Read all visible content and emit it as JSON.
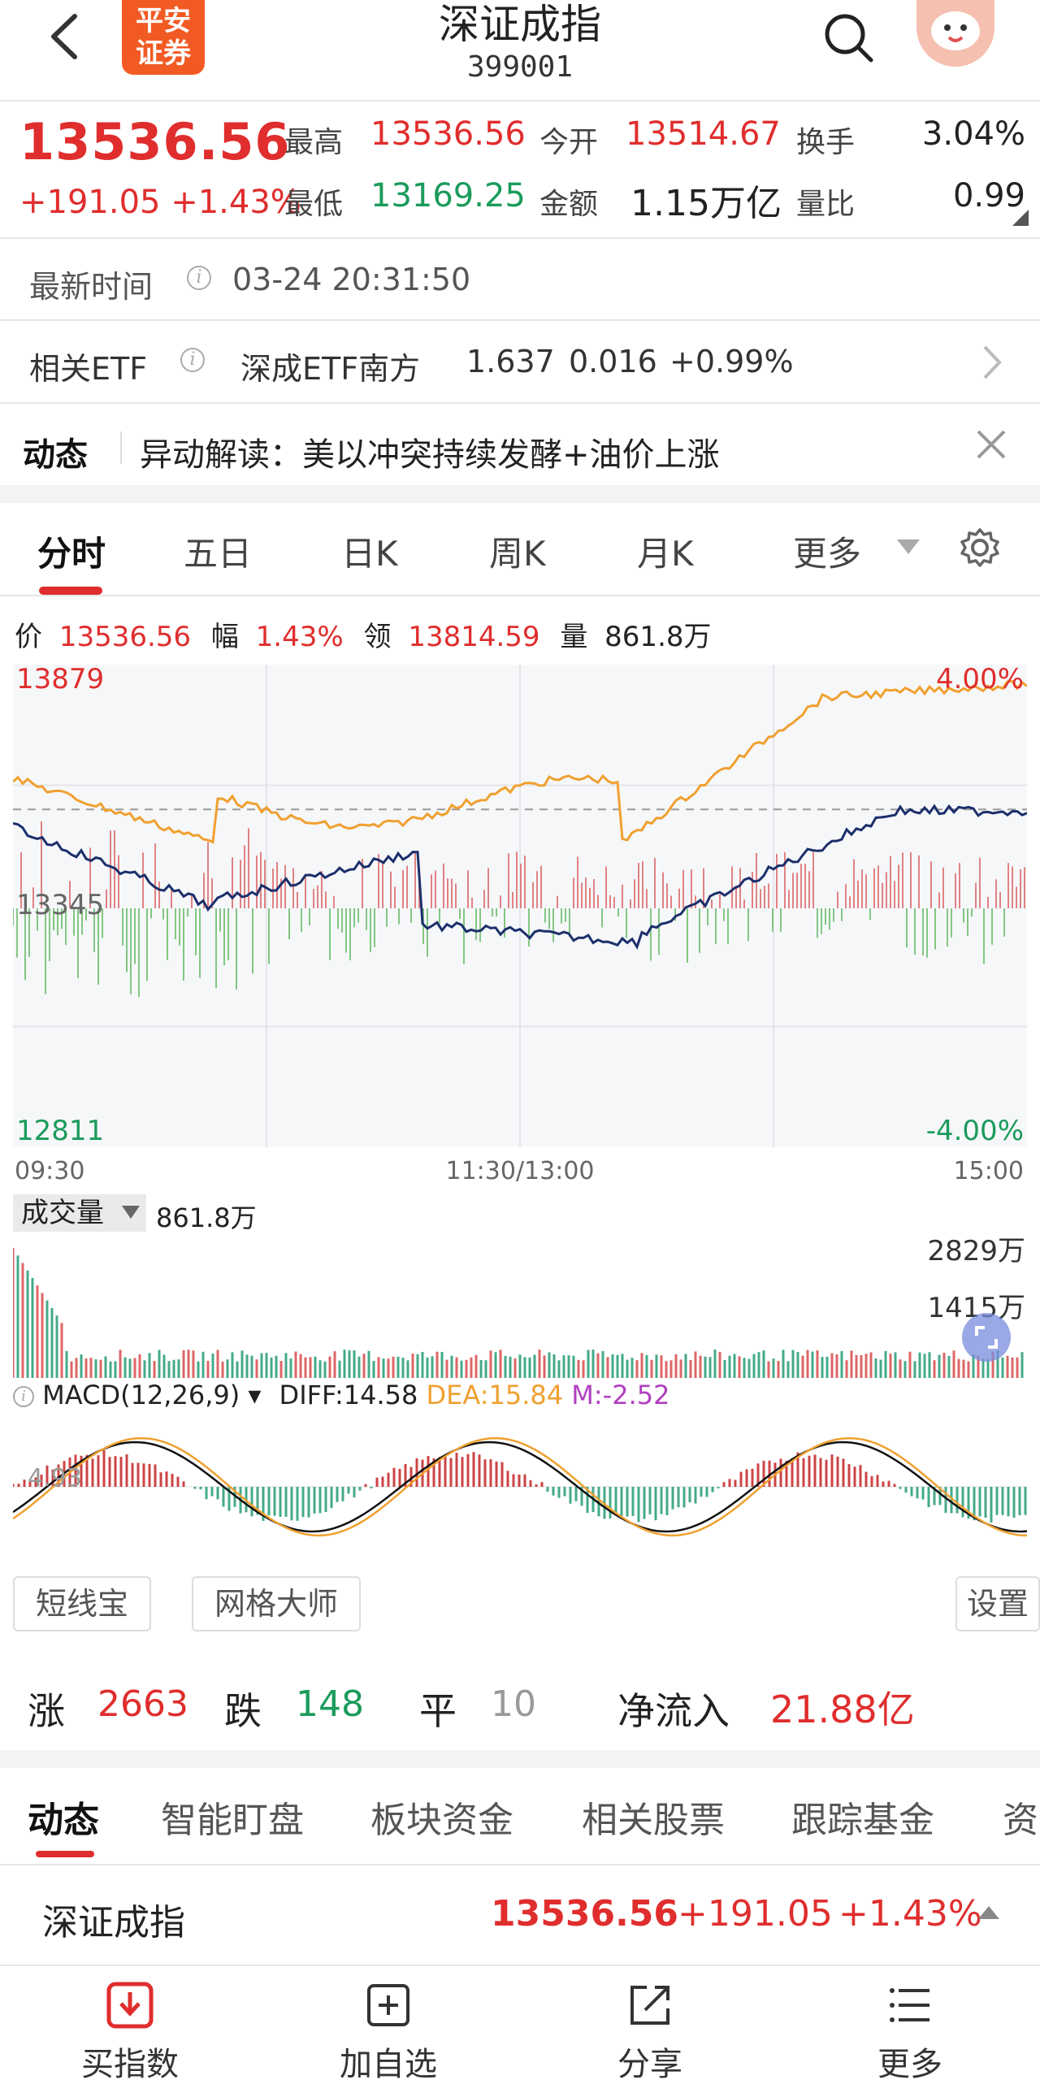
{
  "header": {
    "title": "深证成指",
    "code": "399001",
    "logo_text": "平安证券"
  },
  "quote": {
    "price": "13536.56",
    "change": "+191.05 +1.43%",
    "high_label": "最高",
    "high": "13536.56",
    "open_label": "今开",
    "open": "13514.67",
    "turnover_label": "换手",
    "turnover": "3.04%",
    "low_label": "最低",
    "low": "13169.25",
    "amount_label": "金额",
    "amount": "1.15万亿",
    "volratio_label": "量比",
    "volratio": "0.99"
  },
  "latest_time": {
    "label": "最新时间",
    "value": "03-24 20:31:50"
  },
  "etf": {
    "label": "相关ETF",
    "name": "深成ETF南方",
    "price": "1.637",
    "change": "0.016",
    "pct": "+0.99%"
  },
  "news": {
    "label": "动态",
    "text": "异动解读：美以冲突持续发酵+油价上涨"
  },
  "chart_tabs": [
    "分时",
    "五日",
    "日K",
    "周K",
    "月K",
    "更多"
  ],
  "info_bar": {
    "price_label": "价",
    "price": "13536.56",
    "amp_label": "幅",
    "amp": "1.43%",
    "lead_label": "领",
    "lead": "13814.59",
    "vol_label": "量",
    "vol": "861.8万"
  },
  "intraday": {
    "y_top": "13879",
    "y_mid": "13345",
    "y_bottom": "12811",
    "pct_top": "4.00%",
    "pct_bottom": "-4.00%",
    "x_labels": [
      "09:30",
      "11:30/13:00",
      "15:00"
    ]
  },
  "volume": {
    "label": "成交量",
    "value": "861.8万",
    "max": "2829万",
    "mid": "1415万"
  },
  "macd": {
    "label": "MACD(12,26,9)",
    "diff": "DIFF:14.58",
    "dea": "DEA:15.84",
    "m": "M:-2.52",
    "axis": "4.93"
  },
  "tools": {
    "btn1": "短线宝",
    "btn2": "网格大师",
    "settings": "设置"
  },
  "breadth": {
    "up_label": "涨",
    "up": "2663",
    "down_label": "跌",
    "down": "148",
    "flat_label": "平",
    "flat": "10",
    "inflow_label": "净流入",
    "inflow": "21.88亿"
  },
  "bottom_tabs": [
    "动态",
    "智能盯盘",
    "板块资金",
    "相关股票",
    "跟踪基金",
    "资"
  ],
  "ticker": {
    "name": "深证成指",
    "price": "13536.56",
    "change": "+191.05",
    "pct": "+1.43%"
  },
  "bottom_bar": [
    "买指数",
    "加自选",
    "分享",
    "更多"
  ],
  "colors": {
    "red": "#e02d2d",
    "green": "#1a9b5b",
    "orange": "#f0a030",
    "navy": "#1c2f6b"
  }
}
